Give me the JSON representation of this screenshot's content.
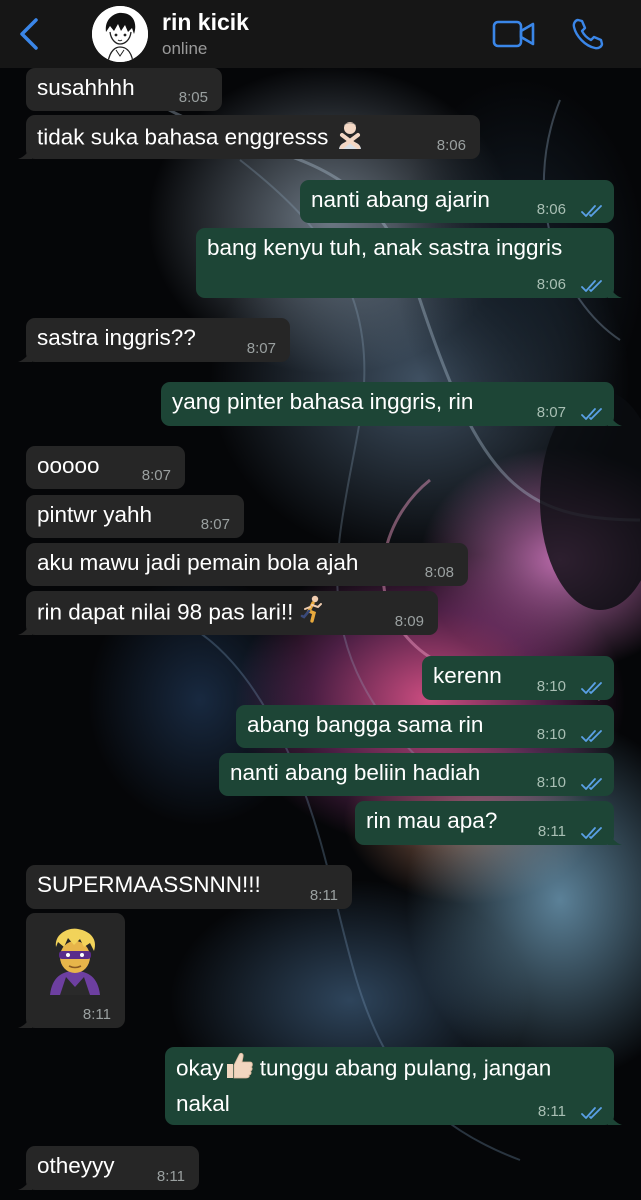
{
  "header": {
    "contact_name": "rin kicik",
    "status": "online"
  },
  "messages": [
    {
      "dir": "in",
      "text": "susahhhh",
      "time": "8:05"
    },
    {
      "dir": "in",
      "text": "tidak suka bahasa enggresss",
      "emoji": "person-gesturing-no",
      "time": "8:06"
    },
    {
      "dir": "out",
      "text": "nanti abang ajarin",
      "time": "8:06",
      "read": true
    },
    {
      "dir": "out",
      "text": "bang kenyu tuh, anak sastra inggris",
      "time": "8:06",
      "read": true
    },
    {
      "dir": "in",
      "text": "sastra inggris??",
      "time": "8:07"
    },
    {
      "dir": "out",
      "text": "yang pinter bahasa inggris, rin",
      "time": "8:07",
      "read": true
    },
    {
      "dir": "in",
      "text": "ooooo",
      "time": "8:07"
    },
    {
      "dir": "in",
      "text": "pintwr yahh",
      "time": "8:07"
    },
    {
      "dir": "in",
      "text": "aku mawu jadi pemain bola ajah",
      "time": "8:08"
    },
    {
      "dir": "in",
      "text": "rin dapat nilai 98 pas lari!!",
      "emoji": "person-running",
      "time": "8:09"
    },
    {
      "dir": "out",
      "text": "kerenn",
      "time": "8:10",
      "read": true
    },
    {
      "dir": "out",
      "text": "abang bangga sama rin",
      "time": "8:10",
      "read": true
    },
    {
      "dir": "out",
      "text": "nanti abang beliin hadiah",
      "time": "8:10",
      "read": true
    },
    {
      "dir": "out",
      "text": "rin mau apa?",
      "time": "8:11",
      "read": true
    },
    {
      "dir": "in",
      "text": "SUPERMAASSNNN!!!",
      "time": "8:11"
    },
    {
      "dir": "in",
      "emoji": "superhero",
      "time": "8:11"
    },
    {
      "dir": "out",
      "text_before": "okay",
      "emoji": "thumbs-up",
      "text_after": " tunggu abang pulang, jangan",
      "text_line2": "nakal",
      "time": "8:11",
      "read": true
    },
    {
      "dir": "in",
      "text": "otheyyy",
      "time": "8:11"
    }
  ],
  "colors": {
    "header_bg": "#161616",
    "accent": "#3a86e8",
    "incoming_bubble": "#262626",
    "outgoing_bubble": "#1d4536",
    "read_tick": "#5aa0e6"
  }
}
